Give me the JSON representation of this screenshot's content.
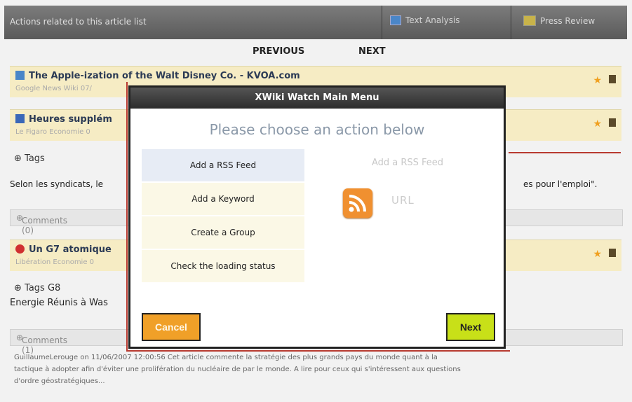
{
  "topbar": {
    "title": "Actions related to this article list",
    "text_analysis": "Text Analysis",
    "press_review": "Press Review"
  },
  "nav": {
    "previous": "PREVIOUS",
    "next": "NEXT"
  },
  "articles": [
    {
      "title": "The Apple-ization of the Walt Disney Co. - KVOA.com",
      "source": "Google News Wiki 07/"
    },
    {
      "title": "Heures supplém",
      "source": "Le Figaro Economie 0"
    },
    {
      "title": "Un G7 atomique",
      "source": "Libération Economie 0"
    }
  ],
  "tags1": "Tags",
  "body1_left": "Selon les syndicats, le",
  "body1_right": "es pour l'emploi\".",
  "comments1": "Comments (0)",
  "tags2": "Tags  G8",
  "body2": "Energie  Réunis à Was",
  "comments2": "Comments (1)",
  "comment_text": {
    "line1": "GuillaumeLerouge  on 11/06/2007 12:00:56 Cet article commente la stratégie des plus grands pays du monde quant à la",
    "line2": "tactique à adopter afin d'éviter une prolifération du nucléaire de par le monde. A lire pour ceux qui s'intéressent aux questions",
    "line3": "d'ordre géostratégiques..."
  },
  "modal": {
    "header": "XWiki Watch Main Menu",
    "title": "Please choose an action below",
    "menu": [
      "Add a RSS Feed",
      "Add a Keyword",
      "Create a Group",
      "Check the loading status"
    ],
    "panel_title": "Add a RSS Feed",
    "url_label": "URL",
    "cancel": "Cancel",
    "next": "Next"
  }
}
